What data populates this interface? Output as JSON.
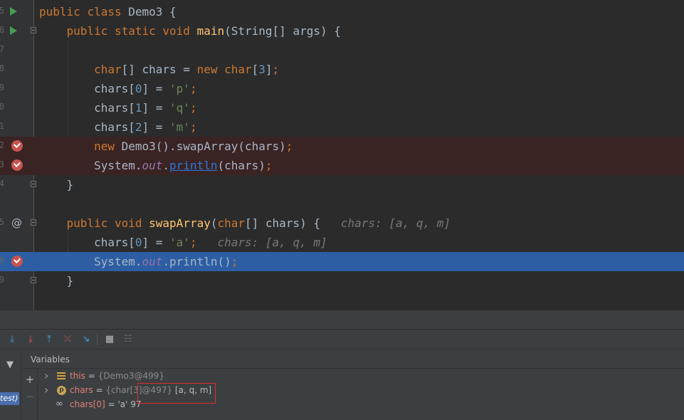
{
  "editor": {
    "line_numbers": [
      "5",
      "6",
      "7",
      "8",
      "9",
      "0",
      "1",
      "2",
      "3",
      "4",
      "",
      "5",
      "",
      "8",
      "9",
      ""
    ],
    "lines": [
      [
        {
          "t": "public ",
          "c": "kw"
        },
        {
          "t": "class ",
          "c": "kw"
        },
        {
          "t": "Demo3 {",
          "c": ""
        }
      ],
      [
        {
          "t": "    public ",
          "c": "kw"
        },
        {
          "t": "static ",
          "c": "kw"
        },
        {
          "t": "void ",
          "c": "kw"
        },
        {
          "t": "main",
          "c": "fn"
        },
        {
          "t": "(String[] args) {",
          "c": ""
        }
      ],
      [],
      [
        {
          "t": "        char",
          "c": "kw"
        },
        {
          "t": "[] chars = ",
          "c": ""
        },
        {
          "t": "new ",
          "c": "kw"
        },
        {
          "t": "char",
          "c": "kw"
        },
        {
          "t": "[",
          "c": ""
        },
        {
          "t": "3",
          "c": "num"
        },
        {
          "t": "]",
          "c": ""
        },
        {
          "t": ";",
          "c": "kw"
        }
      ],
      [
        {
          "t": "        chars[",
          "c": ""
        },
        {
          "t": "0",
          "c": "num"
        },
        {
          "t": "] = ",
          "c": ""
        },
        {
          "t": "'p'",
          "c": "str"
        },
        {
          "t": ";",
          "c": "kw"
        }
      ],
      [
        {
          "t": "        chars[",
          "c": ""
        },
        {
          "t": "1",
          "c": "num"
        },
        {
          "t": "] = ",
          "c": ""
        },
        {
          "t": "'q'",
          "c": "str"
        },
        {
          "t": ";",
          "c": "kw"
        }
      ],
      [
        {
          "t": "        chars[",
          "c": ""
        },
        {
          "t": "2",
          "c": "num"
        },
        {
          "t": "] = ",
          "c": ""
        },
        {
          "t": "'m'",
          "c": "str"
        },
        {
          "t": ";",
          "c": "kw"
        }
      ],
      [
        {
          "t": "        new ",
          "c": "kw"
        },
        {
          "t": "Demo3().swapArray(chars)",
          "c": ""
        },
        {
          "t": ";",
          "c": "kw"
        }
      ],
      [
        {
          "t": "        System.",
          "c": ""
        },
        {
          "t": "out",
          "c": "fld"
        },
        {
          "t": ".",
          "c": ""
        },
        {
          "t": "println",
          "c": "lnk"
        },
        {
          "t": "(chars)",
          "c": ""
        },
        {
          "t": ";",
          "c": "kw"
        }
      ],
      [
        {
          "t": "    }",
          "c": ""
        }
      ],
      [],
      [
        {
          "t": "    public ",
          "c": "kw"
        },
        {
          "t": "void ",
          "c": "kw"
        },
        {
          "t": "swapArray",
          "c": "fn"
        },
        {
          "t": "(",
          "c": ""
        },
        {
          "t": "char",
          "c": "kw"
        },
        {
          "t": "[] chars) {   ",
          "c": ""
        },
        {
          "t": "chars: [a, q, m]",
          "c": "hint"
        }
      ],
      [
        {
          "t": "        chars[",
          "c": ""
        },
        {
          "t": "0",
          "c": "num"
        },
        {
          "t": "] = ",
          "c": ""
        },
        {
          "t": "'a'",
          "c": "str"
        },
        {
          "t": ";   ",
          "c": "kw"
        },
        {
          "t": "chars: [a, q, m]",
          "c": "hint"
        }
      ],
      [
        {
          "t": "        System.",
          "c": ""
        },
        {
          "t": "out",
          "c": "fld"
        },
        {
          "t": ".println()",
          "c": ""
        },
        {
          "t": ";",
          "c": "kw"
        }
      ],
      [
        {
          "t": "    }",
          "c": ""
        }
      ],
      []
    ],
    "breakpoint_lines": [
      7,
      8,
      13
    ],
    "execution_line": 13
  },
  "debugger": {
    "toolbar_icons": [
      "step-over-icon",
      "step-into-icon",
      "step-out-icon",
      "drop-frame-icon",
      "run-to-cursor-icon",
      "evaluate-expression-icon",
      "trace-icon"
    ],
    "variables_title": "Variables",
    "frame_label": "test)",
    "variables": [
      {
        "name": "this",
        "type": "{Demo3@499}",
        "value": "",
        "icon": "field-icon"
      },
      {
        "name": "chars",
        "type": "{char[3]@497}",
        "value": "[a, q, m]",
        "icon": "parameter-icon"
      },
      {
        "name": "chars[0]",
        "type": "",
        "value": "'a' 97",
        "icon": "watch-icon"
      }
    ]
  }
}
